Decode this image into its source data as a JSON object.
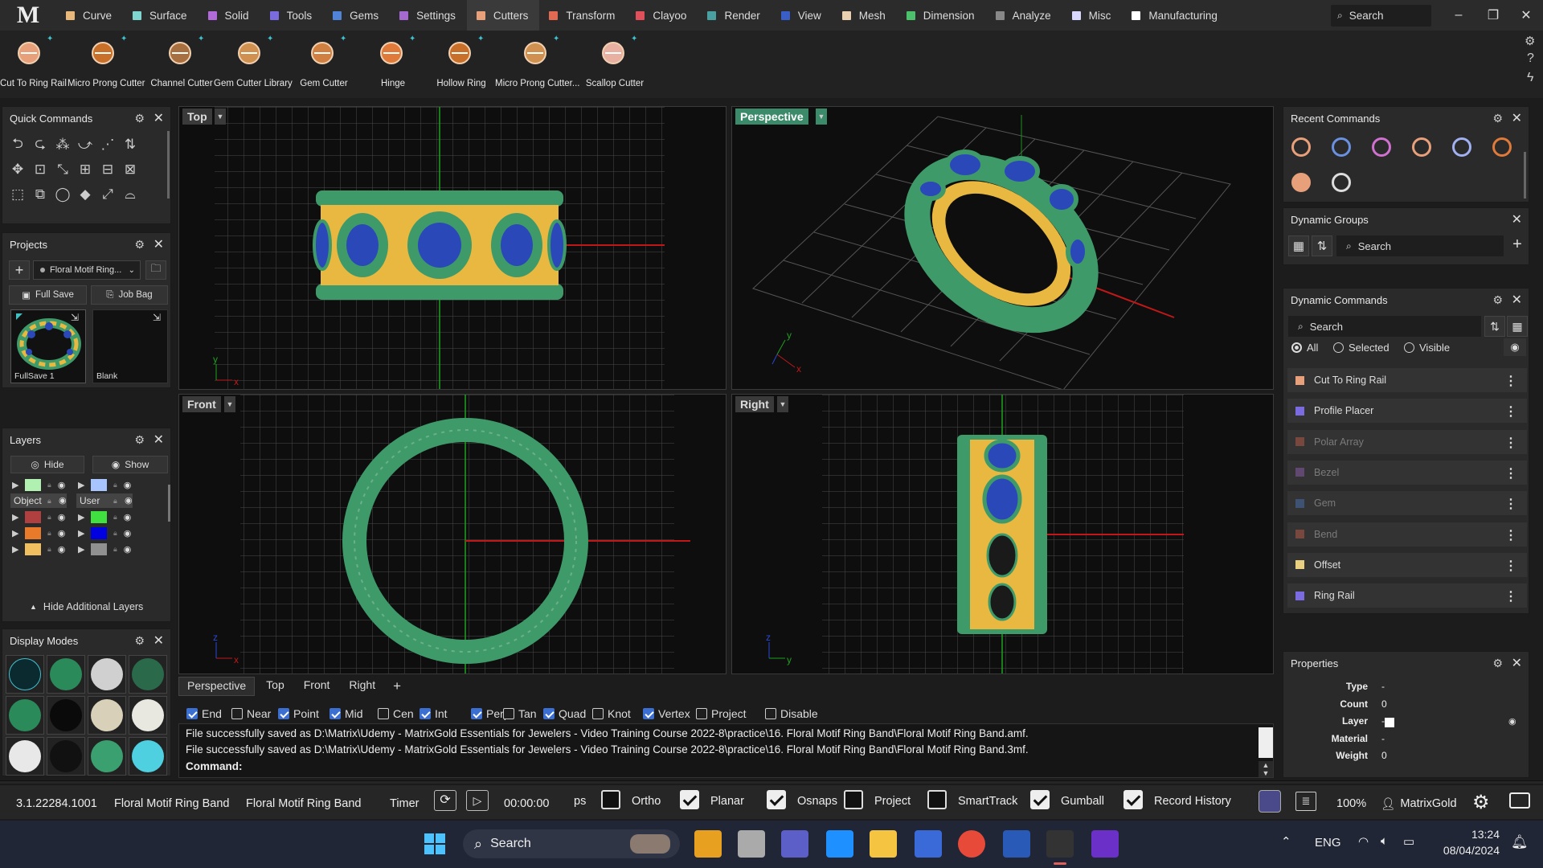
{
  "menu": {
    "logo": "M",
    "tabs": [
      {
        "label": "Curve",
        "color": "#e8b87a"
      },
      {
        "label": "Surface",
        "color": "#7fd6d0"
      },
      {
        "label": "Solid",
        "color": "#b06bd8"
      },
      {
        "label": "Tools",
        "color": "#7a6be0"
      },
      {
        "label": "Gems",
        "color": "#4f84d8"
      },
      {
        "label": "Settings",
        "color": "#a46ad0"
      },
      {
        "label": "Cutters",
        "color": "#e8a07a",
        "active": true
      },
      {
        "label": "Transform",
        "color": "#e26a52"
      },
      {
        "label": "Clayoo",
        "color": "#e0505a"
      },
      {
        "label": "Render",
        "color": "#4aa0a0"
      },
      {
        "label": "View",
        "color": "#3a5ec8"
      },
      {
        "label": "Mesh",
        "color": "#e8d0b0"
      },
      {
        "label": "Dimension",
        "color": "#4cc06a"
      },
      {
        "label": "Analyze",
        "color": "#888888"
      },
      {
        "label": "Misc",
        "color": "#d8d8ff"
      },
      {
        "label": "Manufacturing",
        "color": "#ffffff"
      }
    ],
    "search_label": "Search"
  },
  "toolbar": {
    "tools": [
      {
        "label": "Cut To Ring Rail",
        "icon": "cut-to-ring-rail-icon"
      },
      {
        "label": "Micro Prong Cutter",
        "icon": "micro-prong-cutter-icon"
      },
      {
        "label": "Channel Cutter",
        "icon": "channel-cutter-icon"
      },
      {
        "label": "Gem Cutter Library",
        "icon": "gem-cutter-library-icon"
      },
      {
        "label": "Gem Cutter",
        "icon": "gem-cutter-icon"
      },
      {
        "label": "Hinge",
        "icon": "hinge-icon"
      },
      {
        "label": "Hollow Ring",
        "icon": "hollow-ring-icon"
      },
      {
        "label": "Micro Prong Cutter...",
        "icon": "micro-prong-cutter-options-icon"
      },
      {
        "label": "Scallop Cutter",
        "icon": "scallop-cutter-icon"
      }
    ]
  },
  "quick_commands": {
    "title": "Quick Commands"
  },
  "projects": {
    "title": "Projects",
    "project_name": "Floral Motif Ring...",
    "full_save": "Full Save",
    "job_bag": "Job Bag",
    "thumbs": [
      {
        "label": "FullSave 1"
      },
      {
        "label": "Blank"
      }
    ]
  },
  "layers": {
    "title": "Layers",
    "hide": "Hide",
    "show": "Show",
    "object_label": "Object",
    "user_label": "User",
    "hide_additional": "Hide Additional Layers",
    "left_colors": [
      "#b0f0b0",
      "#7a2fc0",
      "#b04040",
      "#e87a2a",
      "#f0c060"
    ],
    "right_colors": [
      "#a8c4ff",
      "#e02020",
      "#40e040",
      "#0000e0",
      "#909090"
    ]
  },
  "display_modes": {
    "title": "Display Modes"
  },
  "viewports": {
    "top": "Top",
    "perspective": "Perspective",
    "front": "Front",
    "right": "Right",
    "tabs": [
      "Perspective",
      "Top",
      "Front",
      "Right"
    ],
    "add_tab": "+"
  },
  "osnaps": [
    {
      "label": "End",
      "on": true
    },
    {
      "label": "Near",
      "on": false
    },
    {
      "label": "Point",
      "on": true
    },
    {
      "label": "Mid",
      "on": true
    },
    {
      "label": "Cen",
      "on": false
    },
    {
      "label": "Int",
      "on": true
    },
    {
      "label": "Perp",
      "on": true
    },
    {
      "label": "Tan",
      "on": false
    },
    {
      "label": "Quad",
      "on": true
    },
    {
      "label": "Knot",
      "on": false
    },
    {
      "label": "Vertex",
      "on": true
    },
    {
      "label": "Project",
      "on": false
    },
    {
      "label": "Disable",
      "on": false
    }
  ],
  "command": {
    "history": [
      "File successfully saved as D:\\Matrix\\Udemy - MatrixGold Essentials for Jewelers - Video Training Course 2022-8\\practice\\16. Floral Motif Ring Band\\Floral Motif Ring Band.amf.",
      "File successfully saved as D:\\Matrix\\Udemy - MatrixGold Essentials for Jewelers - Video Training Course 2022-8\\practice\\16. Floral Motif Ring Band\\Floral Motif Ring Band.3mf."
    ],
    "prompt": "Command:"
  },
  "recent_commands": {
    "title": "Recent Commands"
  },
  "dynamic_groups": {
    "title": "Dynamic Groups",
    "search": "Search"
  },
  "dynamic_commands": {
    "title": "Dynamic Commands",
    "search": "Search",
    "filter_all": "All",
    "filter_selected": "Selected",
    "filter_visible": "Visible",
    "items": [
      {
        "label": "Cut To Ring Rail",
        "color": "#e8a07a",
        "enabled": true
      },
      {
        "label": "Profile Placer",
        "color": "#7a6be0",
        "enabled": true
      },
      {
        "label": "Polar Array",
        "color": "#e26a52",
        "enabled": false
      },
      {
        "label": "Bezel",
        "color": "#a46ad0",
        "enabled": false
      },
      {
        "label": "Gem",
        "color": "#4f84d8",
        "enabled": false
      },
      {
        "label": "Bend",
        "color": "#e26a52",
        "enabled": false
      },
      {
        "label": "Offset",
        "color": "#e8d080",
        "enabled": true
      },
      {
        "label": "Ring Rail",
        "color": "#7a6be0",
        "enabled": true
      }
    ]
  },
  "properties": {
    "title": "Properties",
    "rows": [
      {
        "key": "Type",
        "value": "-"
      },
      {
        "key": "Count",
        "value": "0"
      },
      {
        "key": "Layer",
        "value": "-"
      },
      {
        "key": "Material",
        "value": "-"
      },
      {
        "key": "Weight",
        "value": "0"
      }
    ]
  },
  "statusbar": {
    "version": "3.1.22284.1001",
    "file1": "Floral Motif Ring Band",
    "file2": "Floral Motif Ring Band",
    "timer": "Timer",
    "time": "00:00:00",
    "ps": "ps",
    "toggles": [
      {
        "label": "Ortho",
        "on": false
      },
      {
        "label": "Planar",
        "on": true
      },
      {
        "label": "Osnaps",
        "on": true
      },
      {
        "label": "Project",
        "on": false
      },
      {
        "label": "SmartTrack",
        "on": false
      },
      {
        "label": "Gumball",
        "on": true
      },
      {
        "label": "Record History",
        "on": true
      }
    ],
    "zoom": "100%",
    "user": "MatrixGold"
  },
  "taskbar": {
    "search": "Search",
    "lang": "ENG",
    "time": "13:24",
    "date": "08/04/2024"
  },
  "colors": {
    "gold": "#e8b840",
    "green": "#3f9a6a",
    "gem": "#2a48b8",
    "accent": "#3b6fd1"
  }
}
